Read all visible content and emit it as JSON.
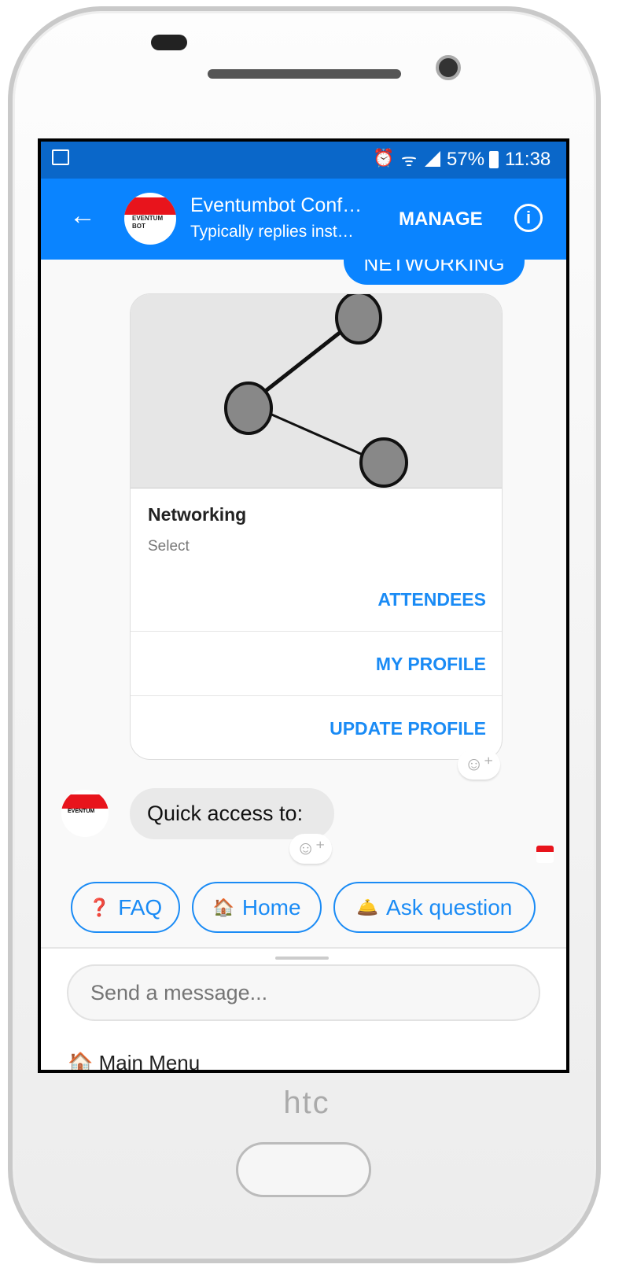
{
  "status_bar": {
    "battery": "57%",
    "time": "11:38",
    "icons": [
      "image-icon",
      "alarm-icon",
      "wifi-icon",
      "signal-icon",
      "battery-icon"
    ]
  },
  "header": {
    "title": "Eventumbot Conf…",
    "subtitle": "Typically replies inst…",
    "manage_label": "MANAGE",
    "avatar_text": [
      "EVENTUM",
      "BOT"
    ]
  },
  "messages": {
    "user_bubble": "NETWORKING",
    "card": {
      "title": "Networking",
      "subtitle": "Select",
      "buttons": [
        "ATTENDEES",
        "MY PROFILE",
        "UPDATE PROFILE"
      ]
    },
    "bot_text": "Quick access to:"
  },
  "quick_replies": [
    {
      "icon": "❓",
      "label": "FAQ"
    },
    {
      "icon": "🏠",
      "label": "Home"
    },
    {
      "icon": "🛎️",
      "label": "Ask question"
    }
  ],
  "composer": {
    "placeholder": "Send a message..."
  },
  "menu": {
    "icon": "🏠",
    "label": "Main Menu"
  },
  "device": {
    "brand": "htc"
  },
  "colors": {
    "accent": "#0a84ff",
    "status_bar": "#0a67c9",
    "link": "#1a8bf5"
  }
}
